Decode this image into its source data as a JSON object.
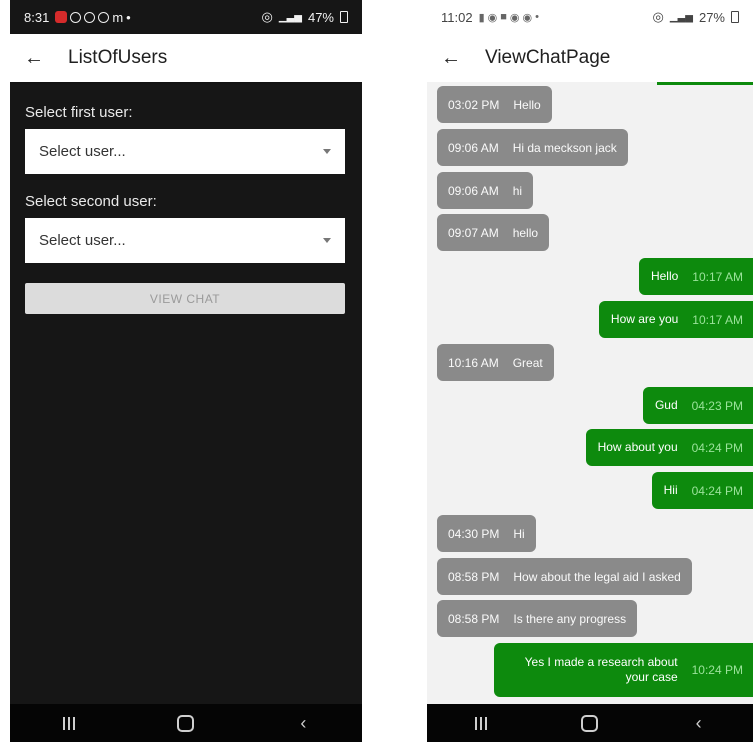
{
  "left": {
    "status": {
      "time": "8:31",
      "extra": "m",
      "battery": "47%"
    },
    "appbar": {
      "title": "ListOfUsers",
      "back": "←"
    },
    "form": {
      "first_label": "Select first user:",
      "first_value": "Select user...",
      "second_label": "Select second user:",
      "second_value": "Select user...",
      "button": "VIEW CHAT"
    }
  },
  "right": {
    "status": {
      "time": "11:02",
      "battery": "27%"
    },
    "appbar": {
      "title": "ViewChatPage",
      "back": "←"
    },
    "messages": [
      {
        "type": "recv",
        "time": "03:02 PM",
        "text": "Hello"
      },
      {
        "type": "recv",
        "time": "09:06 AM",
        "text": "Hi da meckson jack"
      },
      {
        "type": "recv",
        "time": "09:06 AM",
        "text": "hi"
      },
      {
        "type": "recv",
        "time": "09:07 AM",
        "text": "hello"
      },
      {
        "type": "sent",
        "time": "10:17 AM",
        "text": "Hello"
      },
      {
        "type": "sent",
        "time": "10:17 AM",
        "text": "How are you"
      },
      {
        "type": "recv",
        "time": "10:16 AM",
        "text": "Great"
      },
      {
        "type": "sent",
        "time": "04:23 PM",
        "text": "Gud"
      },
      {
        "type": "sent",
        "time": "04:24 PM",
        "text": "How about you"
      },
      {
        "type": "sent",
        "time": "04:24 PM",
        "text": "Hii"
      },
      {
        "type": "recv",
        "time": "04:30 PM",
        "text": "Hi"
      },
      {
        "type": "recv",
        "time": "08:58 PM",
        "text": "How about the legal aid I asked"
      },
      {
        "type": "recv",
        "time": "08:58 PM",
        "text": "Is there any progress"
      },
      {
        "type": "sent",
        "time": "10:24 PM",
        "text": "Yes I made a research about your case"
      }
    ]
  },
  "colors": {
    "sent": "#0d8a0d",
    "recv": "#8a8a8a",
    "dark_bg": "#161616"
  },
  "icons": [
    "back-arrow-icon",
    "dropdown-caret-icon",
    "recents-icon",
    "home-icon",
    "back-nav-icon"
  ]
}
